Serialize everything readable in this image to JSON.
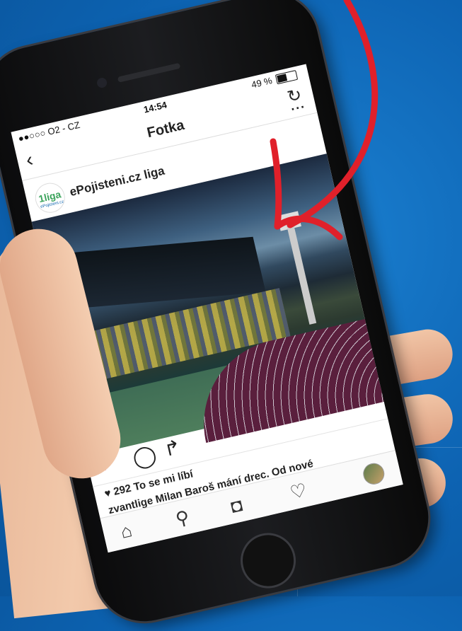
{
  "status_bar": {
    "carrier": "●●○○○ O2 - CZ",
    "time": "14:54",
    "battery_percent": "49 %"
  },
  "navbar": {
    "title": "Fotka",
    "back_icon": "chevron-left-icon",
    "refresh_icon": "refresh-icon",
    "more_icon": "more-icon"
  },
  "post": {
    "account_logo_text": "1liga",
    "account_logo_subtext": "ePojisteni.cz",
    "username": "ePojisteni.cz liga",
    "likes_text": "292 To se mi líbí",
    "caption_text": "zvantlige Milan Baroš mání drec. Od nové"
  },
  "actions": {
    "like_icon": "heart-filled-icon",
    "comment_icon": "comment-icon",
    "share_icon": "share-icon",
    "like_color": "#e8304a"
  },
  "tabbar": {
    "items": [
      "home-icon",
      "search-icon",
      "camera-icon",
      "heart-icon",
      "profile-avatar"
    ]
  },
  "colors": {
    "background": "#0d63b2",
    "annotation_arrow": "#e0202a"
  }
}
